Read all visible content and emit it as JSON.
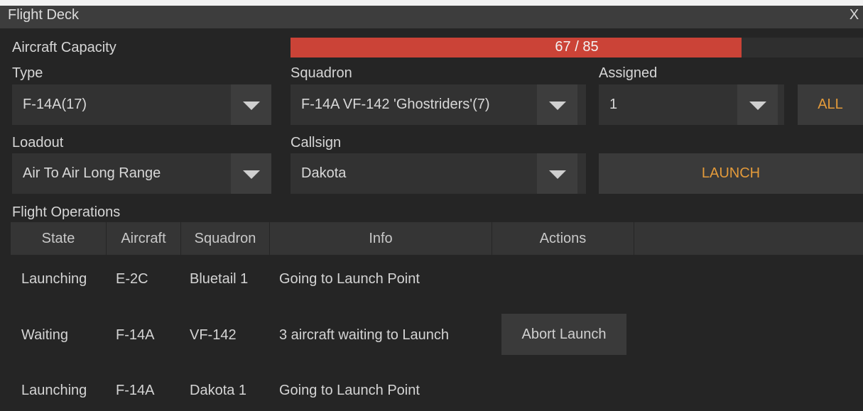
{
  "window": {
    "title": "Flight Deck",
    "close": "X"
  },
  "capacity": {
    "label": "Aircraft Capacity",
    "text": "67 / 85",
    "used": 67,
    "total": 85,
    "fill_color": "#cb4337"
  },
  "type": {
    "label": "Type",
    "value": "F-14A(17)"
  },
  "squadron": {
    "label": "Squadron",
    "value": "F-14A VF-142 'Ghostriders'(7)"
  },
  "assigned": {
    "label": "Assigned",
    "value": "1",
    "all_button": "ALL"
  },
  "loadout": {
    "label": "Loadout",
    "value": "Air To Air Long Range"
  },
  "callsign": {
    "label": "Callsign",
    "value": "Dakota"
  },
  "launch_button": "LAUNCH",
  "operations": {
    "label": "Flight Operations",
    "columns": [
      "State",
      "Aircraft",
      "Squadron",
      "Info",
      "Actions"
    ],
    "rows": [
      {
        "state": "Launching",
        "aircraft": "E-2C",
        "squadron": "Bluetail 1",
        "info": "Going to Launch Point",
        "action": ""
      },
      {
        "state": "Waiting",
        "aircraft": "F-14A",
        "squadron": "VF-142",
        "info": "3 aircraft waiting to Launch",
        "action": "Abort Launch"
      },
      {
        "state": "Launching",
        "aircraft": "F-14A",
        "squadron": "Dakota 1",
        "info": "Going to Launch Point",
        "action": ""
      }
    ]
  },
  "accent_color": "#e39a3a",
  "icons": {
    "dropdown": "chevron-down-icon"
  }
}
